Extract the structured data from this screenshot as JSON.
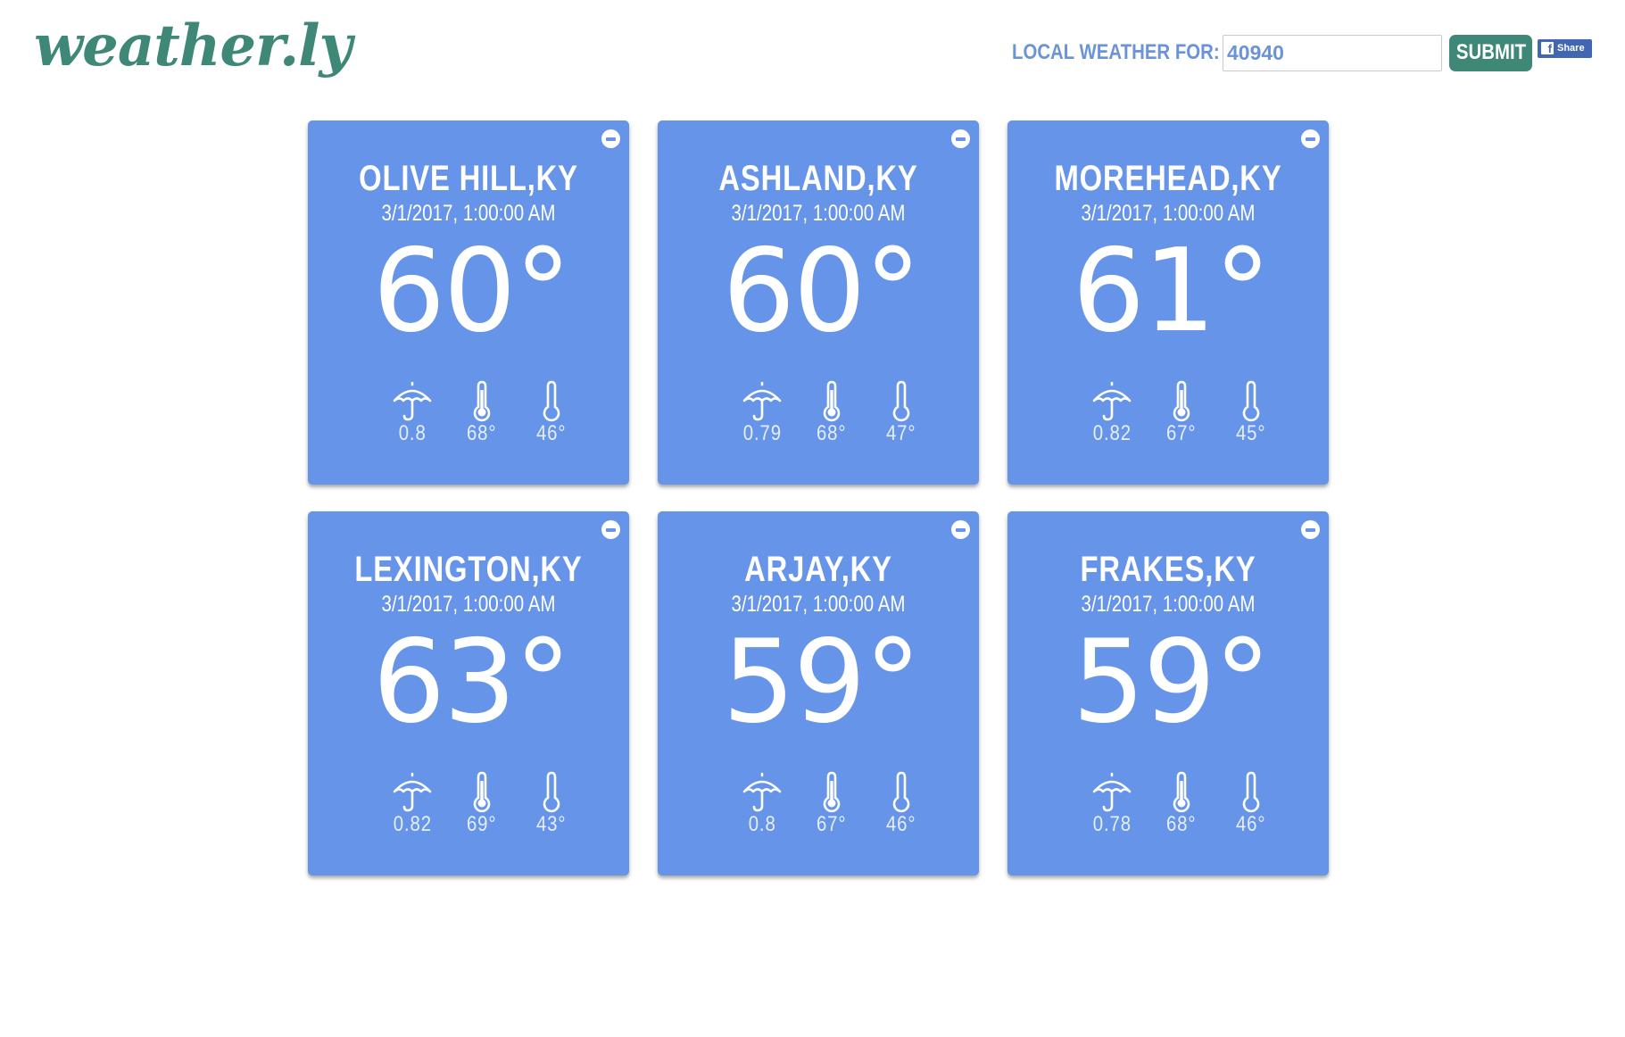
{
  "header": {
    "logo": "weather.ly",
    "search_label": "LOCAL WEATHER FOR:",
    "zip_value": "40940",
    "submit_label": "SUBMIT",
    "share_label": "Share"
  },
  "colors": {
    "card_bg": "#6594e9",
    "brand_green": "#3f8777",
    "label_blue": "#6b93d8",
    "facebook_blue": "#4267b2"
  },
  "icons": [
    "umbrella-icon",
    "thermometer-high-icon",
    "thermometer-low-icon",
    "remove-icon",
    "facebook-icon"
  ],
  "cards": [
    {
      "city": "OLIVE HILL,KY",
      "datetime": "3/1/2017, 1:00:00 AM",
      "temp": "60°",
      "precip": "0.8",
      "high": "68°",
      "low": "46°"
    },
    {
      "city": "ASHLAND,KY",
      "datetime": "3/1/2017, 1:00:00 AM",
      "temp": "60°",
      "precip": "0.79",
      "high": "68°",
      "low": "47°"
    },
    {
      "city": "MOREHEAD,KY",
      "datetime": "3/1/2017, 1:00:00 AM",
      "temp": "61°",
      "precip": "0.82",
      "high": "67°",
      "low": "45°"
    },
    {
      "city": "LEXINGTON,KY",
      "datetime": "3/1/2017, 1:00:00 AM",
      "temp": "63°",
      "precip": "0.82",
      "high": "69°",
      "low": "43°"
    },
    {
      "city": "ARJAY,KY",
      "datetime": "3/1/2017, 1:00:00 AM",
      "temp": "59°",
      "precip": "0.8",
      "high": "67°",
      "low": "46°"
    },
    {
      "city": "FRAKES,KY",
      "datetime": "3/1/2017, 1:00:00 AM",
      "temp": "59°",
      "precip": "0.78",
      "high": "68°",
      "low": "46°"
    }
  ]
}
